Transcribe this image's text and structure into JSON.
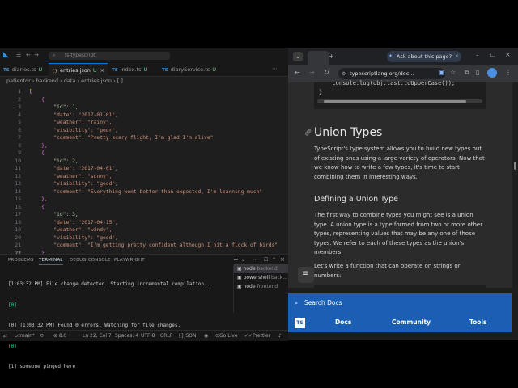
{
  "vscode": {
    "title_search": "fs-typescript",
    "tabs": [
      {
        "label": "diaries.ts",
        "badge": "U",
        "kind": "TS"
      },
      {
        "label": "entries.json",
        "badge": "U",
        "kind": "{}"
      },
      {
        "label": "index.ts",
        "badge": "U",
        "kind": "TS"
      },
      {
        "label": "diaryService.ts",
        "badge": "U",
        "kind": "TS"
      }
    ],
    "breadcrumb": [
      "patientor",
      "backend",
      "data",
      "entries.json",
      "[ ]"
    ],
    "line_numbers": [
      "1",
      "2",
      "3",
      "4",
      "5",
      "6",
      "7",
      "8",
      "9",
      "10",
      "11",
      "12",
      "13",
      "14",
      "15",
      "16",
      "17",
      "18",
      "19",
      "20",
      "21",
      "22"
    ],
    "code_lines": [
      "[",
      "    {",
      "        \"id\": 1,",
      "        \"date\": \"2017-01-01\",",
      "        \"weather\": \"rainy\",",
      "        \"visibility\": \"poor\",",
      "        \"comment\": \"Pretty scary flight, I'm glad I'm alive\"",
      "    },",
      "    {",
      "        \"id\": 2,",
      "        \"date\": \"2017-04-01\",",
      "        \"weather\": \"sunny\",",
      "        \"visibility\": \"good\",",
      "        \"comment\": \"Everything went better than expected, I'm learning much\"",
      "    },",
      "    {",
      "        \"id\": 3,",
      "        \"date\": \"2017-04-15\",",
      "        \"weather\": \"windy\",",
      "        \"visibility\": \"good\",",
      "        \"comment\": \"I'm getting pretty confident although I hit a flock of birds\"",
      "    },"
    ],
    "panel_tabs": [
      "PROBLEMS",
      "TERMINAL",
      "DEBUG CONSOLE",
      "PLAYWRIGHT"
    ],
    "terminal_lines": [
      "[1:03:32 PM] File change detected. Starting incremental compilation...",
      "[0]",
      "[0] [1:03:32 PM] Found 0 errors. Watching for file changes.",
      "[0]",
      "[1] someone pinged here"
    ],
    "terminals": [
      {
        "name": "node",
        "sub": "backend"
      },
      {
        "name": "powershell",
        "sub": "back..."
      },
      {
        "name": "node",
        "sub": "frontend"
      }
    ],
    "status": {
      "branch": "main*",
      "errors": "0",
      "warnings": "0",
      "position": "Ln 22, Col 7",
      "spaces": "Spaces: 4",
      "encoding": "UTF-8",
      "eol": "CRLF",
      "language": "JSON",
      "golive": "Go Live",
      "prettier": "Prettier"
    }
  },
  "browser": {
    "ask_label": "Ask about this page?",
    "url": "typescriptlang.org/doc...",
    "code_snippet": [
      "  console.log(obj.last.toUpperCase());",
      "}"
    ],
    "heading": "Union Types",
    "intro": "TypeScript's type system allows you to build new types out of existing ones using a large variety of operators. Now that we know how to write a few types, it's time to start combining them in interesting ways.",
    "subheading": "Defining a Union Type",
    "para2": "The first way to combine types you might see is a union type. A union type is a type formed from two or more other types, representing values that may be any one of those types. We refer to each of these types as the union's members.",
    "para3": "Let's write a function that can operate on strings or numbers:",
    "search_label": "Search Docs",
    "nav": {
      "logo": "TS",
      "docs": "Docs",
      "community": "Community",
      "tools": "Tools"
    },
    "colors": {
      "accent": "#1a5fb4",
      "page_bg": "#2b2b2b"
    }
  }
}
